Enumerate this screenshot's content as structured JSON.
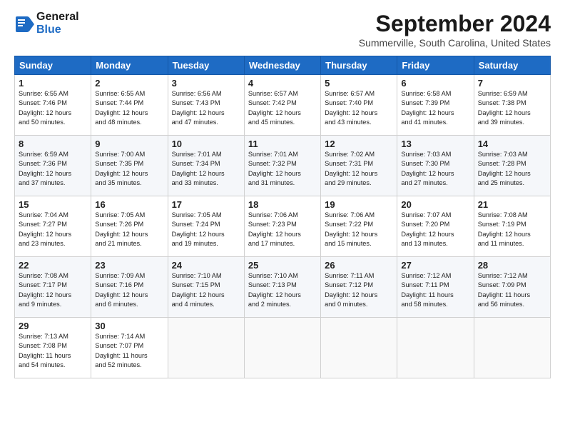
{
  "logo": {
    "line1": "General",
    "line2": "Blue"
  },
  "title": "September 2024",
  "location": "Summerville, South Carolina, United States",
  "weekdays": [
    "Sunday",
    "Monday",
    "Tuesday",
    "Wednesday",
    "Thursday",
    "Friday",
    "Saturday"
  ],
  "weeks": [
    [
      {
        "day": "1",
        "sunrise": "6:55 AM",
        "sunset": "7:46 PM",
        "daylight": "12 hours and 50 minutes."
      },
      {
        "day": "2",
        "sunrise": "6:55 AM",
        "sunset": "7:44 PM",
        "daylight": "12 hours and 48 minutes."
      },
      {
        "day": "3",
        "sunrise": "6:56 AM",
        "sunset": "7:43 PM",
        "daylight": "12 hours and 47 minutes."
      },
      {
        "day": "4",
        "sunrise": "6:57 AM",
        "sunset": "7:42 PM",
        "daylight": "12 hours and 45 minutes."
      },
      {
        "day": "5",
        "sunrise": "6:57 AM",
        "sunset": "7:40 PM",
        "daylight": "12 hours and 43 minutes."
      },
      {
        "day": "6",
        "sunrise": "6:58 AM",
        "sunset": "7:39 PM",
        "daylight": "12 hours and 41 minutes."
      },
      {
        "day": "7",
        "sunrise": "6:59 AM",
        "sunset": "7:38 PM",
        "daylight": "12 hours and 39 minutes."
      }
    ],
    [
      {
        "day": "8",
        "sunrise": "6:59 AM",
        "sunset": "7:36 PM",
        "daylight": "12 hours and 37 minutes."
      },
      {
        "day": "9",
        "sunrise": "7:00 AM",
        "sunset": "7:35 PM",
        "daylight": "12 hours and 35 minutes."
      },
      {
        "day": "10",
        "sunrise": "7:01 AM",
        "sunset": "7:34 PM",
        "daylight": "12 hours and 33 minutes."
      },
      {
        "day": "11",
        "sunrise": "7:01 AM",
        "sunset": "7:32 PM",
        "daylight": "12 hours and 31 minutes."
      },
      {
        "day": "12",
        "sunrise": "7:02 AM",
        "sunset": "7:31 PM",
        "daylight": "12 hours and 29 minutes."
      },
      {
        "day": "13",
        "sunrise": "7:03 AM",
        "sunset": "7:30 PM",
        "daylight": "12 hours and 27 minutes."
      },
      {
        "day": "14",
        "sunrise": "7:03 AM",
        "sunset": "7:28 PM",
        "daylight": "12 hours and 25 minutes."
      }
    ],
    [
      {
        "day": "15",
        "sunrise": "7:04 AM",
        "sunset": "7:27 PM",
        "daylight": "12 hours and 23 minutes."
      },
      {
        "day": "16",
        "sunrise": "7:05 AM",
        "sunset": "7:26 PM",
        "daylight": "12 hours and 21 minutes."
      },
      {
        "day": "17",
        "sunrise": "7:05 AM",
        "sunset": "7:24 PM",
        "daylight": "12 hours and 19 minutes."
      },
      {
        "day": "18",
        "sunrise": "7:06 AM",
        "sunset": "7:23 PM",
        "daylight": "12 hours and 17 minutes."
      },
      {
        "day": "19",
        "sunrise": "7:06 AM",
        "sunset": "7:22 PM",
        "daylight": "12 hours and 15 minutes."
      },
      {
        "day": "20",
        "sunrise": "7:07 AM",
        "sunset": "7:20 PM",
        "daylight": "12 hours and 13 minutes."
      },
      {
        "day": "21",
        "sunrise": "7:08 AM",
        "sunset": "7:19 PM",
        "daylight": "12 hours and 11 minutes."
      }
    ],
    [
      {
        "day": "22",
        "sunrise": "7:08 AM",
        "sunset": "7:17 PM",
        "daylight": "12 hours and 9 minutes."
      },
      {
        "day": "23",
        "sunrise": "7:09 AM",
        "sunset": "7:16 PM",
        "daylight": "12 hours and 6 minutes."
      },
      {
        "day": "24",
        "sunrise": "7:10 AM",
        "sunset": "7:15 PM",
        "daylight": "12 hours and 4 minutes."
      },
      {
        "day": "25",
        "sunrise": "7:10 AM",
        "sunset": "7:13 PM",
        "daylight": "12 hours and 2 minutes."
      },
      {
        "day": "26",
        "sunrise": "7:11 AM",
        "sunset": "7:12 PM",
        "daylight": "12 hours and 0 minutes."
      },
      {
        "day": "27",
        "sunrise": "7:12 AM",
        "sunset": "7:11 PM",
        "daylight": "11 hours and 58 minutes."
      },
      {
        "day": "28",
        "sunrise": "7:12 AM",
        "sunset": "7:09 PM",
        "daylight": "11 hours and 56 minutes."
      }
    ],
    [
      {
        "day": "29",
        "sunrise": "7:13 AM",
        "sunset": "7:08 PM",
        "daylight": "11 hours and 54 minutes."
      },
      {
        "day": "30",
        "sunrise": "7:14 AM",
        "sunset": "7:07 PM",
        "daylight": "11 hours and 52 minutes."
      },
      null,
      null,
      null,
      null,
      null
    ]
  ]
}
